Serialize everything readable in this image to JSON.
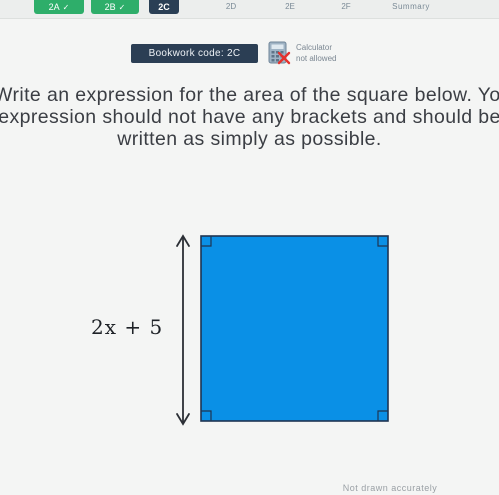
{
  "tabs": [
    {
      "label": "2A",
      "state": "done"
    },
    {
      "label": "2B",
      "state": "done"
    },
    {
      "label": "2C",
      "state": "current"
    },
    {
      "label": "2D",
      "state": "todo"
    },
    {
      "label": "2E",
      "state": "todo"
    },
    {
      "label": "2F",
      "state": "todo"
    },
    {
      "label": "Summary",
      "state": "summary"
    }
  ],
  "bookwork": {
    "label": "Bookwork code: 2C"
  },
  "calculator": {
    "line1": "Calculator",
    "line2": "not allowed"
  },
  "question": {
    "lines": [
      "Write an expression for the area of the square below. Your",
      "expression should not have any brackets and should be",
      "written as simply as possible."
    ]
  },
  "figure": {
    "side_length": "2x + 5",
    "fill_color": "#0a90e6",
    "stroke_color": "#1f3552"
  },
  "footnote": "Not drawn accurately",
  "colors": {
    "done_tab": "#2eae6a",
    "current_tab": "#2a3f55",
    "bookwork_bg": "#2b3e54"
  }
}
